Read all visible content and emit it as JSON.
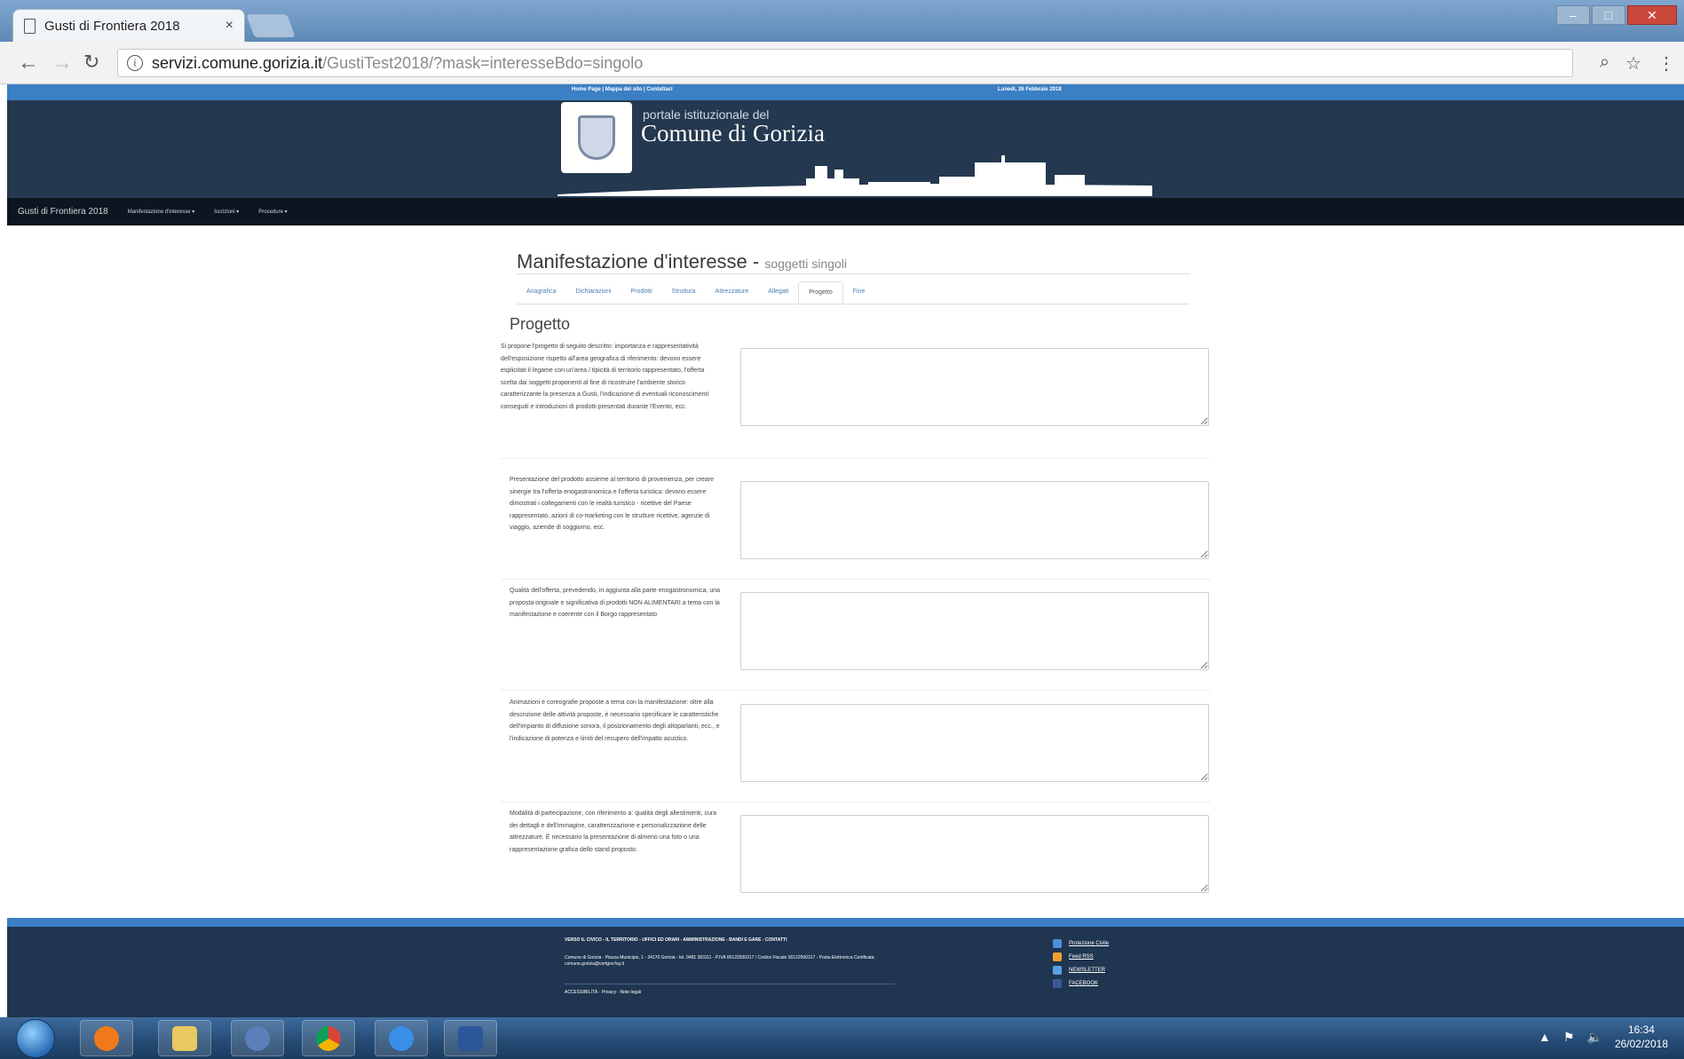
{
  "browser": {
    "tab_title": "Gusti di Frontiera 2018",
    "tab_close": "×",
    "url_host": "servizi.comune.gorizia.it",
    "url_path": "/GustiTest2018/?mask=interesseBdo=singolo",
    "window_minimize": "–",
    "window_maximize": "□",
    "window_close": "✕"
  },
  "site": {
    "top_left_links": "Home Page | Mappa del sito | Contattaci",
    "top_right_date": "Lunedì, 26 Febbraio 2018",
    "portal_label": "portale istituzionale del",
    "name": "Comune di Gorizia"
  },
  "menubar": {
    "brand": "Gusti di Frontiera 2018",
    "items": [
      "Manifestazione d'interesse ▾",
      "Iscrizioni ▾",
      "Procedure ▾"
    ]
  },
  "page": {
    "title": "Manifestazione d'interesse",
    "title_separator": "-",
    "subtitle": "soggetti singoli",
    "tabs": [
      "Anagrafica",
      "Dichiarazioni",
      "Prodotti",
      "Struttura",
      "Attrezzature",
      "Allegati",
      "Progetto",
      "Fine"
    ],
    "active_tab": "Progetto",
    "section_title": "Progetto"
  },
  "questions": [
    {
      "label": "Si propone l'progetto di seguito descritto: importanza e rappresentatività dell'esposizione rispetto all'area geografica di riferimento: devono essere esplicitati il legame con un'area / tipicità di territorio rappresentato, l'offerta scelta dai soggetti proponenti al fine di ricostruire l'ambiente storico caratterizzante la presenza a Gusti, l'indicazione di eventuali riconoscimenti conseguiti e introduzioni di prodotti presentati durante l'Evento, ecc.",
      "value": ""
    },
    {
      "label": "Presentazione del prodotto assieme al territorio di provenienza, per creare sinergie tra l'offerta enogastronomica e l'offerta turistica: devono essere dimostrati i collegamenti con le realtà turistico - ricettive del Paese rappresentato, azioni di co-marketing con le strutture ricettive, agenzie di viaggio, aziende di soggiorno, ecc.",
      "value": ""
    },
    {
      "label": "Qualità dell'offerta, prevedendo, in aggiunta alla parte enogastronomica, una proposta originale e significativa di prodotti NON ALIMENTARI a tema con la manifestazione e coerente con il Borgo rappresentato",
      "value": ""
    },
    {
      "label": "Animazioni e coreografie proposte a tema con la manifestazione: oltre alla descrizione delle attività proposte, è necessario specificare le caratteristiche dell'impianto di diffusione sonora, il posizionamento degli altoparlanti, ecc., e l'indicazione di potenza e limiti del recupero dell'impatto acustico.",
      "value": ""
    },
    {
      "label": "Modalità di partecipazione, con riferimento a: qualità degli allestimenti, cura dei dettagli e dell'immagine, caratterizzazione e personalizzazione delle attrezzature. È necessario la presentazione di almeno una foto o una rappresentazione grafica dello stand proposto.",
      "value": ""
    }
  ],
  "footer": {
    "links": "VERSO IL CIVICO - IL TERRITORIO - UFFICI ED ORARI - AMMINISTRAZIONE - BANDI E GARE - CONTATTI",
    "address": "Comune di Gorizia - Piazza Municipio, 1 - 34170 Gorizia - tel. 0481 383111 - P.IVA 00122500317 / Codice Fiscale 00122500317 - Posta Elettronica Certificata: comune.gorizia@certgov.fvg.it",
    "bottom": "ACCESSIBILITÀ - Privacy - Note legali",
    "social": [
      "Protezione Civile",
      "Feed RSS",
      "NEWSLETTER",
      "FACEBOOK"
    ]
  },
  "taskbar": {
    "time": "16:34",
    "date": "26/02/2018"
  },
  "colors": {
    "header_bg": "#24384f",
    "accent_blue": "#3b7fc4",
    "menubar_bg": "#0d1620"
  }
}
